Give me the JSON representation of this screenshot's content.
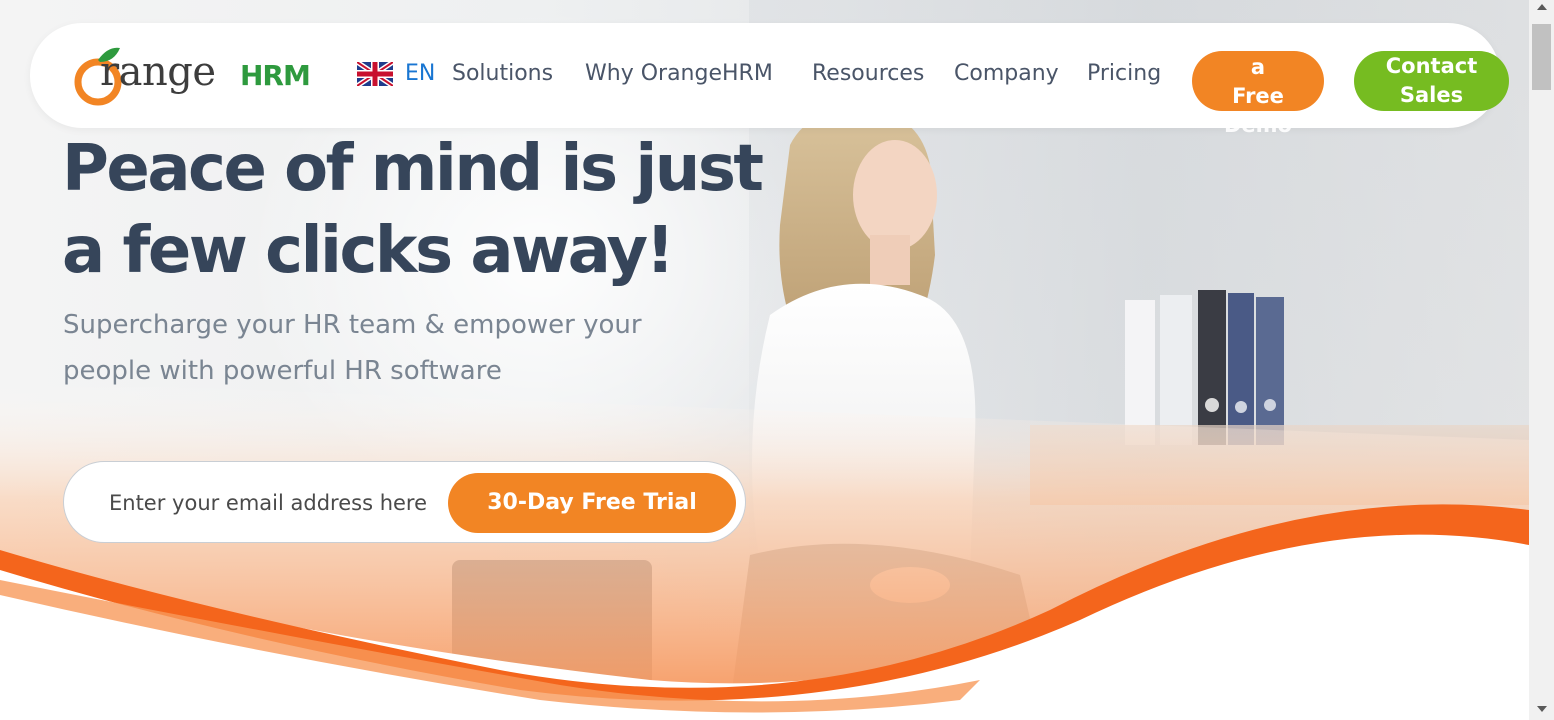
{
  "header": {
    "logo": {
      "text": "range",
      "brand": "HRM",
      "leaf_color": "#2e9a3e",
      "orange_color": "#f28524"
    },
    "language": {
      "code": "EN",
      "flag_icon": "uk-flag-icon"
    },
    "nav": [
      "Solutions",
      "Why OrangeHRM",
      "Resources",
      "Company",
      "Pricing"
    ],
    "demo_button": {
      "line1": "a",
      "line2": "Free",
      "line3": "Demo"
    },
    "sales_button": {
      "line1": "Contact",
      "line2": "Sales"
    }
  },
  "hero": {
    "headline_line1": "Peace of mind is just",
    "headline_line2": "a few clicks away!",
    "sub_line1": "Supercharge your HR team & empower your",
    "sub_line2": "people with powerful HR software",
    "email_placeholder": "Enter your email address here",
    "trial_button": "30-Day Free Trial"
  },
  "colors": {
    "orange": "#f28524",
    "green": "#76bc21",
    "headline": "#36455a",
    "nav_text": "#4a5568",
    "link_blue": "#1976d2"
  }
}
